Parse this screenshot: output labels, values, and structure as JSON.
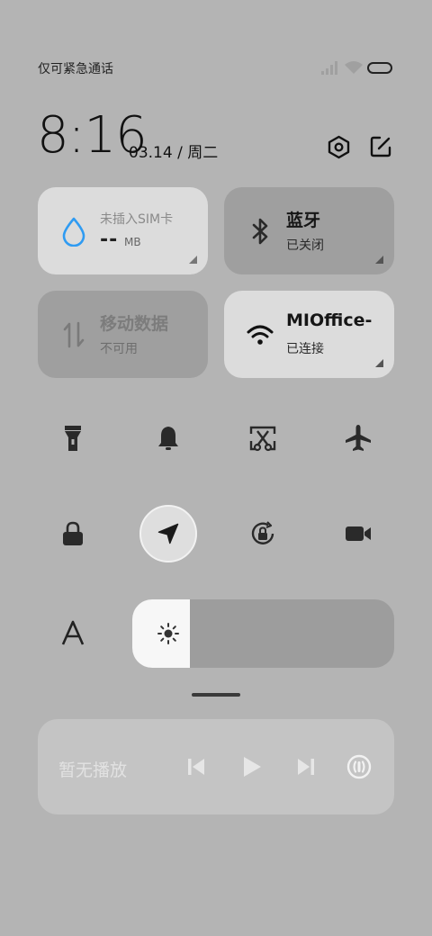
{
  "status_bar": {
    "text": "仅可紧急通话",
    "icons": [
      "signal-icon",
      "wifi-icon",
      "battery-icon"
    ]
  },
  "clock": {
    "time": "8:16",
    "date": "03.14 / 周二"
  },
  "header_icons": [
    "settings-icon",
    "edit-icon"
  ],
  "tiles": {
    "sim": {
      "title": "未插入SIM卡",
      "value": "--",
      "unit": "MB",
      "icon": "water-drop-icon",
      "accent": "#2f9bf2"
    },
    "bluetooth": {
      "title": "蓝牙",
      "subtitle": "已关闭",
      "icon": "bluetooth-icon"
    },
    "mobile_data": {
      "title": "移动数据",
      "subtitle": "不可用",
      "icon": "data-arrows-icon"
    },
    "wifi": {
      "title": "MIOffice-",
      "subtitle": "已连接",
      "icon": "wifi-icon"
    }
  },
  "toggles_row1": [
    "flashlight-icon",
    "bell-icon",
    "screenshot-icon",
    "airplane-icon"
  ],
  "toggles_row2": [
    "lock-icon",
    "location-icon",
    "rotation-lock-icon",
    "video-icon"
  ],
  "brightness": {
    "level_percent": 22,
    "icon": "sun-icon",
    "font_icon": "font-size-icon"
  },
  "media": {
    "text": "暂无播放",
    "controls": [
      "previous-icon",
      "play-icon",
      "next-icon",
      "cast-icon"
    ]
  },
  "colors": {
    "background": "#b4b4b4",
    "tile_on": "#dcdcdc",
    "tile_off": "#9f9f9f",
    "accent": "#2f9bf2"
  }
}
